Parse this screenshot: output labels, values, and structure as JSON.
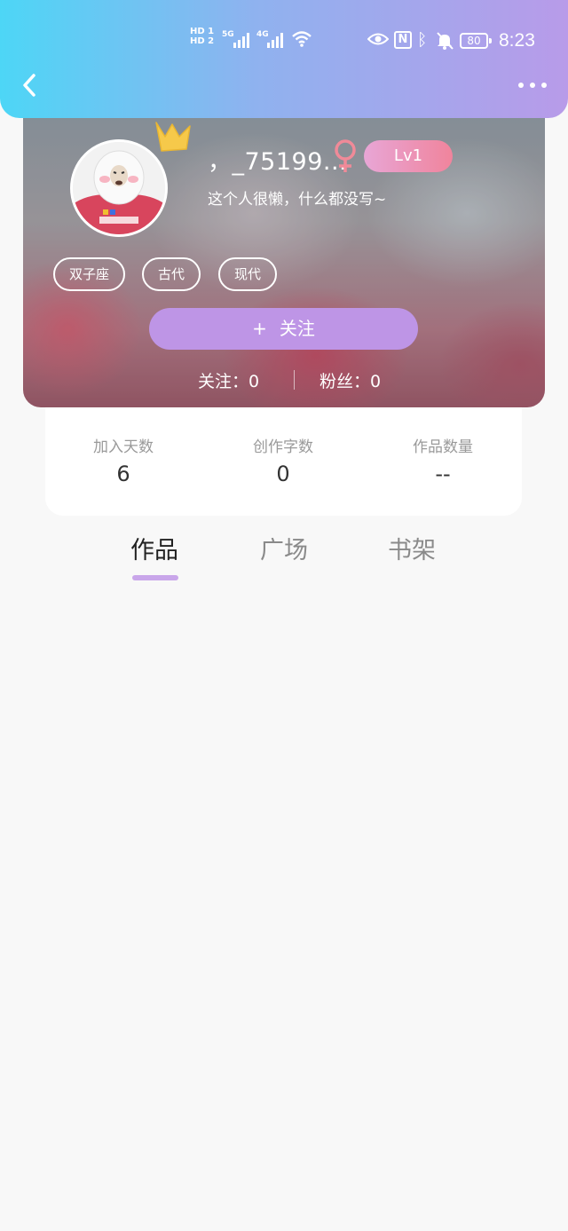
{
  "status_bar": {
    "hd1": "HD 1",
    "hd2": "HD 2",
    "net1": "5G",
    "net2": "4G",
    "battery": "80",
    "time": "8:23"
  },
  "profile": {
    "username": "，_75199...",
    "level": "Lv1",
    "bio": "这个人很懒，什么都没写~",
    "tags": [
      "双子座",
      "古代",
      "现代"
    ],
    "follow_plus": "+",
    "follow_label": "关注",
    "following_label": "关注：",
    "following_value": "0",
    "fans_label": "粉丝：",
    "fans_value": "0"
  },
  "stats": [
    {
      "label": "加入天数",
      "value": "6"
    },
    {
      "label": "创作字数",
      "value": "0"
    },
    {
      "label": "作品数量",
      "value": "--"
    }
  ],
  "tabs": [
    {
      "label": "作品",
      "active": true
    },
    {
      "label": "广场",
      "active": false
    },
    {
      "label": "书架",
      "active": false
    }
  ],
  "colors": {
    "header_gradient_start": "#4dd6f6",
    "header_gradient_end": "#b89be9",
    "follow_button": "#be95e6",
    "level_badge_start": "#e8a6d6",
    "level_badge_end": "#f0849c",
    "tab_indicator": "#c9a6ea"
  },
  "icons": [
    "back-arrow-icon",
    "more-dots-icon",
    "crown-icon",
    "female-icon",
    "wifi-icon",
    "eye-icon",
    "nfc-icon",
    "bluetooth-icon",
    "bell-muted-icon"
  ]
}
